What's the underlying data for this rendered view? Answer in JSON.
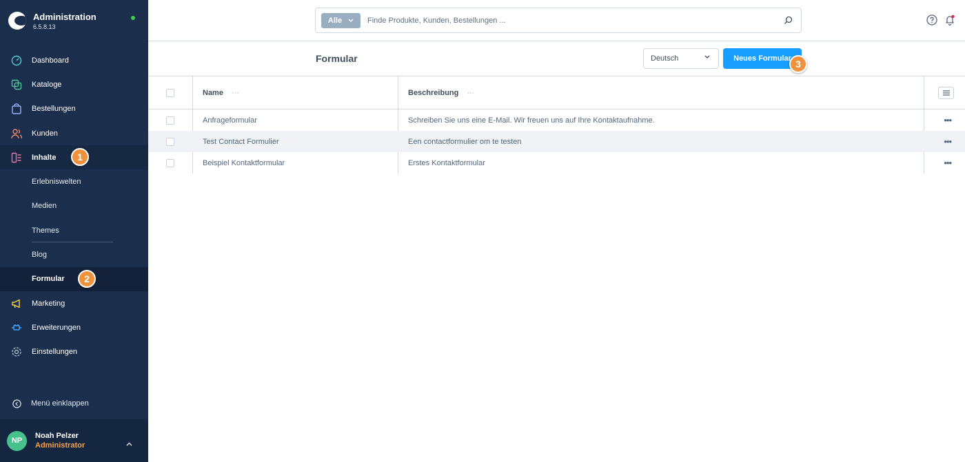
{
  "app": {
    "title": "Administration",
    "version": "6.5.8.13",
    "status_color": "#37d046"
  },
  "sidebar": {
    "items": [
      {
        "label": "Dashboard",
        "icon": "gauge-icon"
      },
      {
        "label": "Kataloge",
        "icon": "catalog-icon"
      },
      {
        "label": "Bestellungen",
        "icon": "bag-icon"
      },
      {
        "label": "Kunden",
        "icon": "users-icon"
      },
      {
        "label": "Inhalte",
        "icon": "content-icon"
      }
    ],
    "subitems": [
      {
        "label": "Erlebniswelten"
      },
      {
        "label": "Medien"
      },
      {
        "label": "Themes"
      },
      {
        "label": "Blog"
      },
      {
        "label": "Formular"
      }
    ],
    "items_after": [
      {
        "label": "Marketing",
        "icon": "megaphone-icon"
      },
      {
        "label": "Erweiterungen",
        "icon": "plug-icon"
      },
      {
        "label": "Einstellungen",
        "icon": "gear-icon"
      }
    ],
    "collapse_label": "Menü einklappen"
  },
  "user": {
    "initials": "NP",
    "name": "Noah Pelzer",
    "role": "Administrator"
  },
  "search": {
    "type_label": "Alle",
    "placeholder": "Finde Produkte, Kunden, Bestellungen ..."
  },
  "page": {
    "title": "Formular",
    "language": "Deutsch",
    "new_button": "Neues Formular"
  },
  "grid": {
    "columns": [
      {
        "label": "Name"
      },
      {
        "label": "Beschreibung"
      }
    ],
    "rows": [
      {
        "name": "Anfrageformular",
        "description": "Schreiben Sie uns eine E-Mail. Wir freuen uns auf Ihre Kontaktaufnahme."
      },
      {
        "name": "Test Contact Formulier",
        "description": "Een contactformulier om te testen"
      },
      {
        "name": "Beispiel Kontaktformular",
        "description": "Erstes Kontaktformular"
      }
    ]
  },
  "annotations": {
    "step1": "1",
    "step2": "2",
    "step3": "3"
  },
  "colors": {
    "sidebar": "#1b2f4c",
    "primary": "#189eff",
    "step_badge": "#f0923d",
    "role": "#f5a248"
  }
}
